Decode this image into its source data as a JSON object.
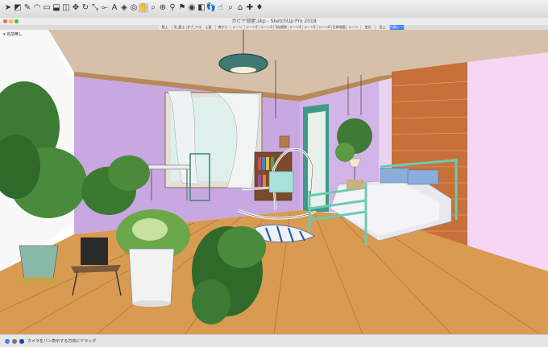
{
  "window": {
    "title": "カビヤ部屋.skp - SketchUp Pro 2018"
  },
  "toolbar": {
    "tools": [
      {
        "icon": "select-icon",
        "glyph": "➤"
      },
      {
        "icon": "eraser-icon",
        "glyph": "◩"
      },
      {
        "icon": "pencil-icon",
        "glyph": "✎"
      },
      {
        "icon": "arc-icon",
        "glyph": "◠"
      },
      {
        "icon": "rectangle-icon",
        "glyph": "▭"
      },
      {
        "icon": "push-pull-icon",
        "glyph": "⬓"
      },
      {
        "icon": "offset-icon",
        "glyph": "◫"
      },
      {
        "icon": "move-icon",
        "glyph": "✥"
      },
      {
        "icon": "rotate-icon",
        "glyph": "↻"
      },
      {
        "icon": "scale-icon",
        "glyph": "⤡"
      },
      {
        "icon": "tape-measure-icon",
        "glyph": "⟜"
      },
      {
        "icon": "text-icon",
        "glyph": "A"
      },
      {
        "icon": "paint-bucket-icon",
        "glyph": "◈"
      },
      {
        "icon": "orbit-icon",
        "glyph": "◎"
      },
      {
        "icon": "pan-icon",
        "glyph": "✋"
      },
      {
        "icon": "zoom-icon",
        "glyph": "⌕"
      },
      {
        "icon": "zoom-extents-icon",
        "glyph": "⊕"
      },
      {
        "icon": "walk-icon",
        "glyph": "⚲"
      },
      {
        "icon": "position-camera-icon",
        "glyph": "⚑"
      },
      {
        "icon": "look-around-icon",
        "glyph": "◉"
      },
      {
        "icon": "section-plane-icon",
        "glyph": "◧"
      },
      {
        "icon": "footprints-icon",
        "glyph": "👣"
      },
      {
        "icon": "hand-icon",
        "glyph": "☝"
      },
      {
        "icon": "magnifier-icon",
        "glyph": "⌕"
      },
      {
        "icon": "warehouse-icon",
        "glyph": "⌂"
      },
      {
        "icon": "extension-icon",
        "glyph": "✚"
      },
      {
        "icon": "ruby-icon",
        "glyph": "♦"
      }
    ]
  },
  "scenes": {
    "tabs": [
      "屋上",
      "吊_屋上",
      "ダブ_ベランダ屋上",
      "上面",
      "南から",
      "シーン",
      "シーン2",
      "シーン3",
      "3点透視",
      "シーン4",
      "シーン5",
      "シーン6",
      "立体地図",
      "シーン",
      "逆光",
      "見上",
      "内観シーン"
    ],
    "active_tab": "内観シーン"
  },
  "viewport": {
    "layer_label": "▾ 名前無し"
  },
  "status": {
    "text": "カメラをパン表示する方向にドラッグ"
  },
  "colors": {
    "wall_left": "#c9a8e0",
    "wall_back": "#cfb0e8",
    "ceiling": "#d8c4b0",
    "floor": "#d99a52",
    "brick": "#c8703a",
    "pink_wall": "#f6d4f2",
    "teal": "#4fa89a",
    "active_tab": "#3b82f6"
  }
}
